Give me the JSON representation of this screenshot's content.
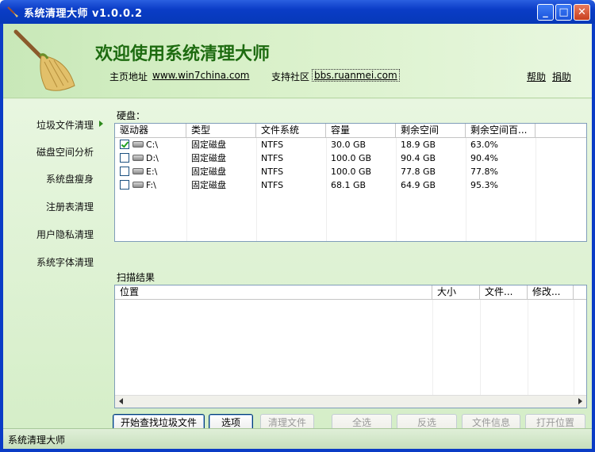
{
  "window": {
    "title": "系统清理大师 v1.0.0.2",
    "minimize": "_",
    "maximize": "□",
    "close": "✕"
  },
  "header": {
    "title": "欢迎使用系统清理大师",
    "homepage_label": "主页地址",
    "homepage_link": "www.win7china.com",
    "community_label": "支持社区",
    "community_link": "bbs.ruanmei.com",
    "help": "帮助",
    "donate": "捐助"
  },
  "sidebar": {
    "items": [
      {
        "label": "垃圾文件清理",
        "active": true
      },
      {
        "label": "磁盘空间分析",
        "active": false
      },
      {
        "label": "系统盘瘦身",
        "active": false
      },
      {
        "label": "注册表清理",
        "active": false
      },
      {
        "label": "用户隐私清理",
        "active": false
      },
      {
        "label": "系统字体清理",
        "active": false
      }
    ]
  },
  "disks": {
    "section_label": "硬盘：",
    "columns": [
      "驱动器",
      "类型",
      "文件系统",
      "容量",
      "剩余空间",
      "剩余空间百..."
    ],
    "rows": [
      {
        "checked": true,
        "drive": "C:\\",
        "type": "固定磁盘",
        "fs": "NTFS",
        "capacity": "30.0 GB",
        "free": "18.9 GB",
        "free_pct": "63.0%"
      },
      {
        "checked": false,
        "drive": "D:\\",
        "type": "固定磁盘",
        "fs": "NTFS",
        "capacity": "100.0 GB",
        "free": "90.4 GB",
        "free_pct": "90.4%"
      },
      {
        "checked": false,
        "drive": "E:\\",
        "type": "固定磁盘",
        "fs": "NTFS",
        "capacity": "100.0 GB",
        "free": "77.8 GB",
        "free_pct": "77.8%"
      },
      {
        "checked": false,
        "drive": "F:\\",
        "type": "固定磁盘",
        "fs": "NTFS",
        "capacity": "68.1 GB",
        "free": "64.9 GB",
        "free_pct": "95.3%"
      }
    ]
  },
  "results": {
    "section_label": "扫描结果",
    "columns": [
      "位置",
      "大小",
      "文件...",
      "修改..."
    ]
  },
  "buttons": {
    "start_scan": "开始查找垃圾文件",
    "options": "选项",
    "clean_files": "清理文件",
    "select_all": "全选",
    "invert_selection": "反选",
    "file_info": "文件信息",
    "open_location": "打开位置"
  },
  "status": {
    "text": "系统清理大师"
  },
  "colors": {
    "titlebar": "#0a3cc6",
    "header_title": "#1d6b10",
    "panel_bg": "#dff0d5"
  }
}
